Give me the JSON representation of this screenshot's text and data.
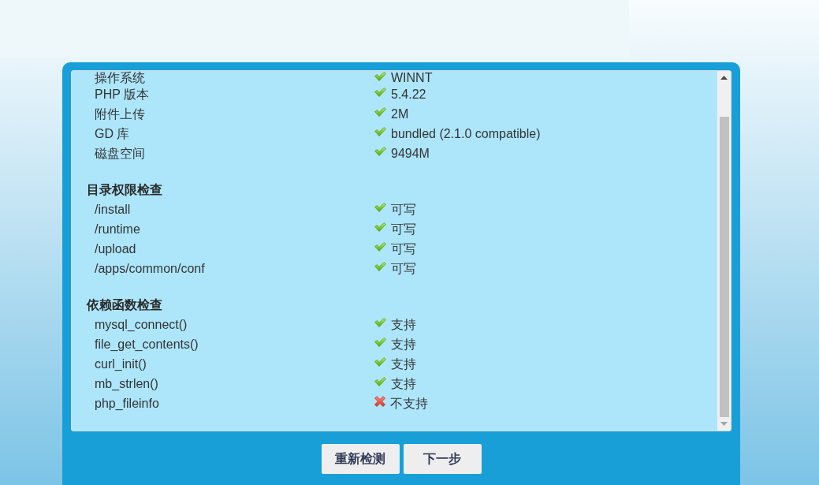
{
  "sections": [
    {
      "items": [
        {
          "label": "操作系统",
          "value": "WINNT",
          "passed": true
        },
        {
          "label": "PHP 版本",
          "value": "5.4.22",
          "passed": true
        },
        {
          "label": "附件上传",
          "value": "2M",
          "passed": true
        },
        {
          "label": "GD 库",
          "value": "bundled (2.1.0 compatible)",
          "passed": true
        },
        {
          "label": "磁盘空间",
          "value": "9494M",
          "passed": true
        }
      ]
    },
    {
      "title": "目录权限检查",
      "items": [
        {
          "label": "/install",
          "value": "可写",
          "passed": true
        },
        {
          "label": "/runtime",
          "value": "可写",
          "passed": true
        },
        {
          "label": "/upload",
          "value": "可写",
          "passed": true
        },
        {
          "label": "/apps/common/conf",
          "value": "可写",
          "passed": true
        }
      ]
    },
    {
      "title": "依赖函数检查",
      "items": [
        {
          "label": "mysql_connect()",
          "value": "支持",
          "passed": true
        },
        {
          "label": "file_get_contents()",
          "value": "支持",
          "passed": true
        },
        {
          "label": "curl_init()",
          "value": "支持",
          "passed": true
        },
        {
          "label": "mb_strlen()",
          "value": "支持",
          "passed": true
        },
        {
          "label": "php_fileinfo",
          "value": "不支持",
          "passed": false
        }
      ]
    }
  ],
  "buttons": [
    "重新检测",
    "下一步"
  ]
}
